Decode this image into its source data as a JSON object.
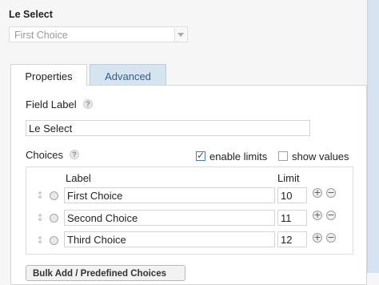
{
  "field": {
    "title": "Le Select",
    "preview_value": "First Choice"
  },
  "tabs": [
    {
      "label": "Properties"
    },
    {
      "label": "Advanced"
    }
  ],
  "properties": {
    "field_label_heading": "Field Label",
    "field_label_value": "Le Select",
    "choices_heading": "Choices",
    "enable_limits_label": "enable limits",
    "enable_limits_checked": true,
    "show_values_label": "show values",
    "show_values_checked": false,
    "col_label": "Label",
    "col_limit": "Limit",
    "choices": [
      {
        "label": "First Choice",
        "limit": "10"
      },
      {
        "label": "Second Choice",
        "limit": "11"
      },
      {
        "label": "Third Choice",
        "limit": "12"
      }
    ],
    "bulk_button_label": "Bulk Add / Predefined Choices"
  },
  "icons": {
    "help": "help-icon",
    "drag": "drag-handle-icon",
    "add": "plus-circle-icon",
    "remove": "minus-circle-icon",
    "dropdown": "chevron-down-icon"
  },
  "colors": {
    "active_tab_bg": "#ffffff",
    "inactive_tab_bg": "#d6e4f0",
    "inactive_tab_text": "#2f5f8a",
    "check_color": "#1d4c89"
  }
}
